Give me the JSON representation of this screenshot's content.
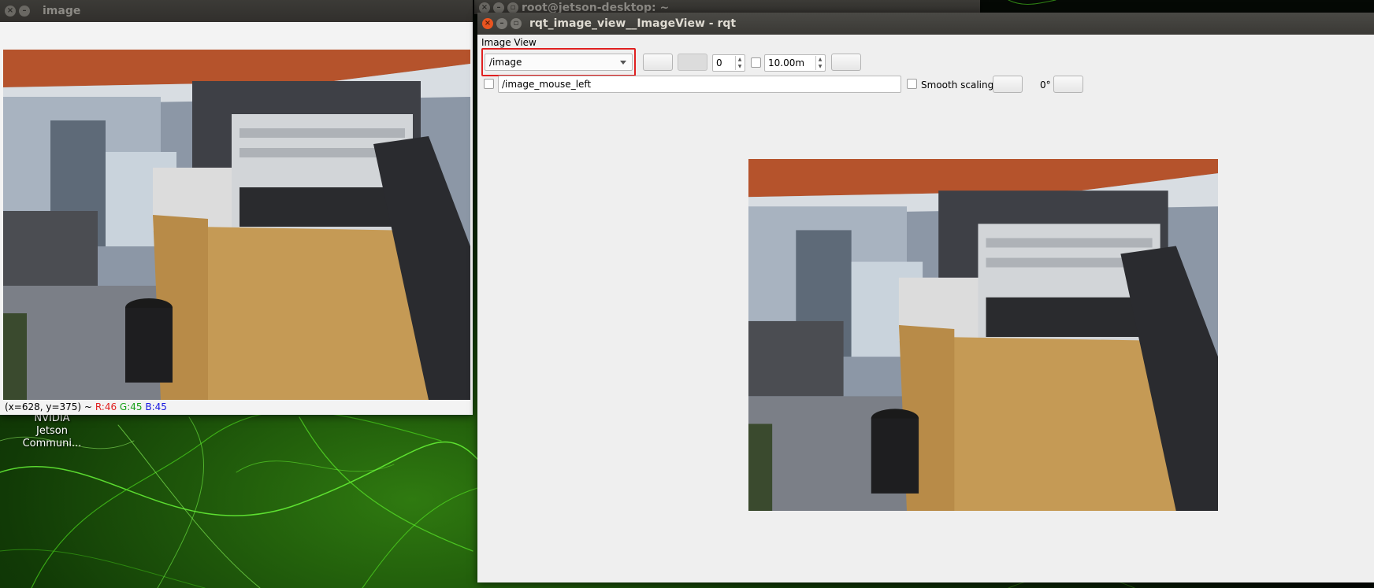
{
  "desktop": {
    "icon_label_lines": [
      "NVIDIA",
      "Jetson",
      "Communi..."
    ]
  },
  "image_window": {
    "title": "image",
    "status": {
      "coords": "(x=628, y=375) ~",
      "r": "R:46",
      "g": "G:45",
      "b": "B:45"
    }
  },
  "terminal_window": {
    "title": "root@jetson-desktop: ~"
  },
  "rqt_window": {
    "title": "rqt_image_view__ImageView - rqt",
    "plugin_label": "Image View",
    "topic_combo_value": "/image",
    "spin_value": "0",
    "range_value": "10.00m",
    "mouse_topic_value": "/image_mouse_left",
    "smooth_scaling_label": "Smooth scaling",
    "rotation_label": "0°",
    "highlight_color": "#e02020"
  },
  "icons": {
    "close": "close-icon",
    "minimize": "minimize-icon",
    "maximize": "maximize-icon",
    "dropdown": "chevron-down-icon"
  }
}
